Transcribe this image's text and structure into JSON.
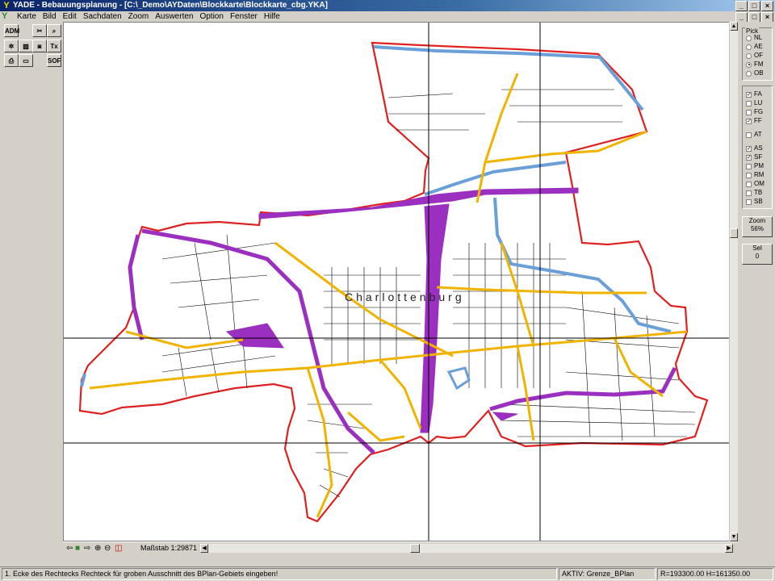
{
  "window": {
    "title": "YADE - Bebauungsplanung - [C:\\_Demo\\AYDaten\\Blockkarte\\Blockkarte_cbg.YKA]"
  },
  "menu": [
    "Karte",
    "Bild",
    "Edit",
    "Sachdaten",
    "Zoom",
    "Auswerten",
    "Option",
    "Fenster",
    "Hilfe"
  ],
  "toolbox": {
    "buttons": [
      "ADM",
      "SOF",
      "Tx"
    ]
  },
  "map": {
    "district_label": "Charlottenburg",
    "colors": {
      "boundary": "#e02020",
      "roads_major": "#f0b400",
      "rail": "#9b2fc0",
      "water": "#6a9fd8",
      "streets": "#000000"
    }
  },
  "bottom": {
    "scale_text": "Maßstab 1:29871"
  },
  "pick": {
    "title": "Pick",
    "options": [
      {
        "label": "NL",
        "selected": false
      },
      {
        "label": "AE",
        "selected": false
      },
      {
        "label": "OF",
        "selected": false
      },
      {
        "label": "FM",
        "selected": true
      },
      {
        "label": "OB",
        "selected": false
      }
    ]
  },
  "layers": [
    {
      "label": "FA",
      "checked": true
    },
    {
      "label": "LU",
      "checked": false
    },
    {
      "label": "FG",
      "checked": false
    },
    {
      "label": "FF",
      "checked": true
    },
    {
      "label": "AT",
      "checked": false
    },
    {
      "label": "AS",
      "checked": true
    },
    {
      "label": "SF",
      "checked": true
    },
    {
      "label": "PM",
      "checked": false
    },
    {
      "label": "RM",
      "checked": false
    },
    {
      "label": "OM",
      "checked": false
    },
    {
      "label": "TB",
      "checked": false
    },
    {
      "label": "SB",
      "checked": false
    }
  ],
  "zoom": {
    "label": "Zoom",
    "value": "56%"
  },
  "sel": {
    "label": "Sel",
    "value": "0"
  },
  "status": {
    "message": "1. Ecke des Rechtecks Rechteck für groben Ausschnitt des BPlan-Gebiets eingeben!",
    "active": "AKTIV: Grenze_BPlan",
    "coords": "R=193300.00 H=161350.00"
  }
}
